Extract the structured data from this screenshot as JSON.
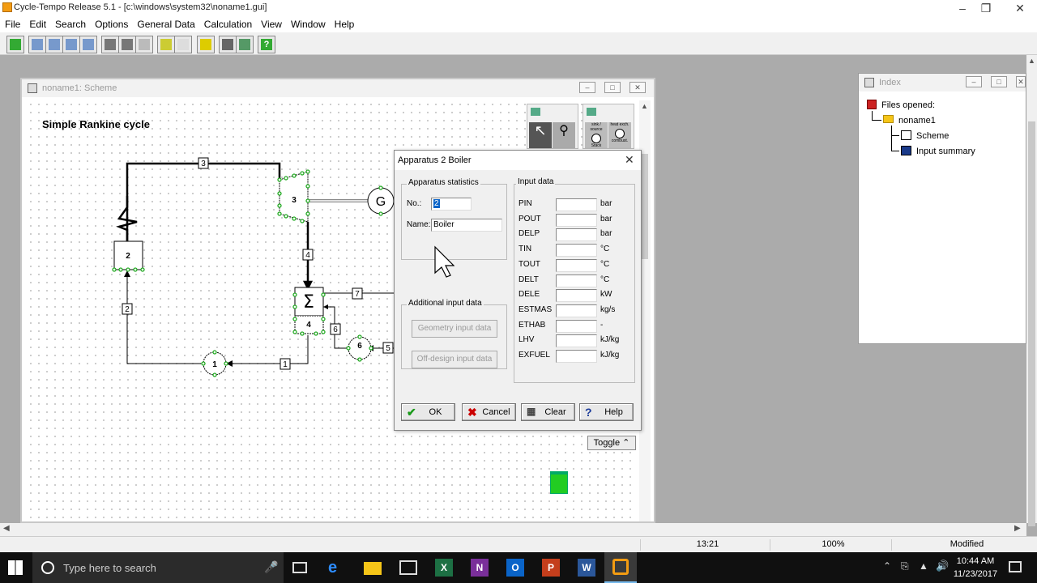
{
  "app": {
    "title": "Cycle-Tempo Release 5.1 - [c:\\windows\\system32\\noname1.gui]"
  },
  "menu": [
    "File",
    "Edit",
    "Search",
    "Options",
    "General Data",
    "Calculation",
    "View",
    "Window",
    "Help"
  ],
  "scheme": {
    "window_title": "noname1: Scheme",
    "cycle_title": "Simple Rankine cycle",
    "apparatus": [
      "2",
      "3",
      "4",
      "1",
      "6"
    ],
    "pipes": [
      "3",
      "4",
      "7",
      "2",
      "6",
      "5",
      "1"
    ],
    "generator": "G",
    "palette1_labels": [
      "sink / source",
      "heat exch.",
      "Stack",
      "combust."
    ],
    "toggle": "Toggle"
  },
  "index": {
    "window_title": "Index",
    "files_opened": "Files opened:",
    "project": "noname1",
    "items": [
      "Scheme",
      "Input summary"
    ]
  },
  "dialog": {
    "title": "Apparatus 2  Boiler",
    "stats_group": "Apparatus statistics",
    "no_label": "No.:",
    "no_value": "2",
    "name_label": "Name:",
    "name_value": "Boiler",
    "additional_group": "Additional input data",
    "geometry_btn": "Geometry input data",
    "offdesign_btn": "Off-design input data",
    "input_group": "Input data",
    "inputs": [
      {
        "name": "PIN",
        "unit": "bar"
      },
      {
        "name": "POUT",
        "unit": "bar"
      },
      {
        "name": "DELP",
        "unit": "bar"
      },
      {
        "name": "TIN",
        "unit": "°C"
      },
      {
        "name": "TOUT",
        "unit": "°C"
      },
      {
        "name": "DELT",
        "unit": "°C"
      },
      {
        "name": "DELE",
        "unit": "kW"
      },
      {
        "name": "ESTMAS",
        "unit": "kg/s"
      },
      {
        "name": "ETHAB",
        "unit": "-"
      },
      {
        "name": "LHV",
        "unit": "kJ/kg"
      },
      {
        "name": "EXFUEL",
        "unit": "kJ/kg"
      }
    ],
    "ok": "OK",
    "cancel": "Cancel",
    "clear": "Clear",
    "help": "Help"
  },
  "status": {
    "position": "13:21",
    "zoom": "100%",
    "state": "Modified"
  },
  "taskbar": {
    "search_placeholder": "Type here to search",
    "time": "10:44 AM",
    "date": "11/23/2017"
  },
  "colors": {
    "node_green": "#22aa22",
    "trash_green": "#22cc22",
    "accent": "#0a64c8"
  }
}
